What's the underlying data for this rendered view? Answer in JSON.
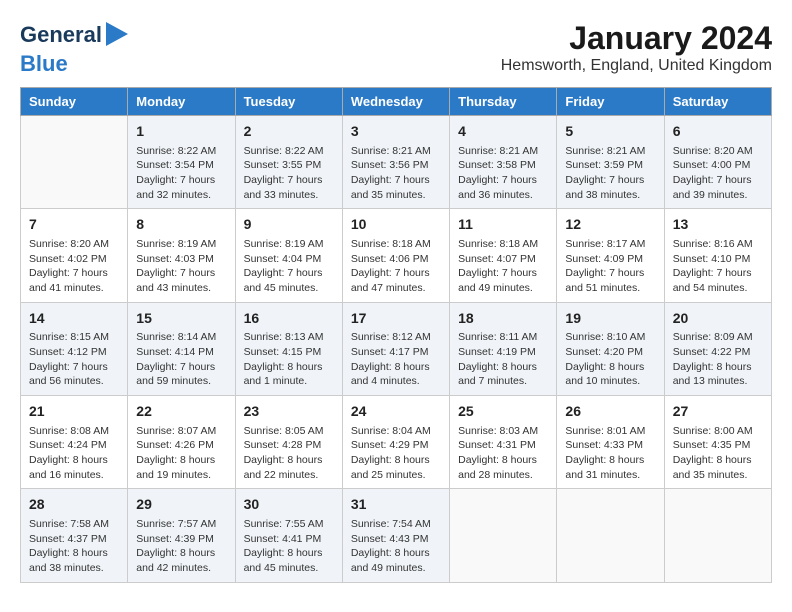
{
  "logo": {
    "line1": "General",
    "line2": "Blue"
  },
  "title": "January 2024",
  "subtitle": "Hemsworth, England, United Kingdom",
  "days_of_week": [
    "Sunday",
    "Monday",
    "Tuesday",
    "Wednesday",
    "Thursday",
    "Friday",
    "Saturday"
  ],
  "weeks": [
    [
      {
        "day": "",
        "sunrise": "",
        "sunset": "",
        "daylight": ""
      },
      {
        "day": "1",
        "sunrise": "Sunrise: 8:22 AM",
        "sunset": "Sunset: 3:54 PM",
        "daylight": "Daylight: 7 hours and 32 minutes."
      },
      {
        "day": "2",
        "sunrise": "Sunrise: 8:22 AM",
        "sunset": "Sunset: 3:55 PM",
        "daylight": "Daylight: 7 hours and 33 minutes."
      },
      {
        "day": "3",
        "sunrise": "Sunrise: 8:21 AM",
        "sunset": "Sunset: 3:56 PM",
        "daylight": "Daylight: 7 hours and 35 minutes."
      },
      {
        "day": "4",
        "sunrise": "Sunrise: 8:21 AM",
        "sunset": "Sunset: 3:58 PM",
        "daylight": "Daylight: 7 hours and 36 minutes."
      },
      {
        "day": "5",
        "sunrise": "Sunrise: 8:21 AM",
        "sunset": "Sunset: 3:59 PM",
        "daylight": "Daylight: 7 hours and 38 minutes."
      },
      {
        "day": "6",
        "sunrise": "Sunrise: 8:20 AM",
        "sunset": "Sunset: 4:00 PM",
        "daylight": "Daylight: 7 hours and 39 minutes."
      }
    ],
    [
      {
        "day": "7",
        "sunrise": "Sunrise: 8:20 AM",
        "sunset": "Sunset: 4:02 PM",
        "daylight": "Daylight: 7 hours and 41 minutes."
      },
      {
        "day": "8",
        "sunrise": "Sunrise: 8:19 AM",
        "sunset": "Sunset: 4:03 PM",
        "daylight": "Daylight: 7 hours and 43 minutes."
      },
      {
        "day": "9",
        "sunrise": "Sunrise: 8:19 AM",
        "sunset": "Sunset: 4:04 PM",
        "daylight": "Daylight: 7 hours and 45 minutes."
      },
      {
        "day": "10",
        "sunrise": "Sunrise: 8:18 AM",
        "sunset": "Sunset: 4:06 PM",
        "daylight": "Daylight: 7 hours and 47 minutes."
      },
      {
        "day": "11",
        "sunrise": "Sunrise: 8:18 AM",
        "sunset": "Sunset: 4:07 PM",
        "daylight": "Daylight: 7 hours and 49 minutes."
      },
      {
        "day": "12",
        "sunrise": "Sunrise: 8:17 AM",
        "sunset": "Sunset: 4:09 PM",
        "daylight": "Daylight: 7 hours and 51 minutes."
      },
      {
        "day": "13",
        "sunrise": "Sunrise: 8:16 AM",
        "sunset": "Sunset: 4:10 PM",
        "daylight": "Daylight: 7 hours and 54 minutes."
      }
    ],
    [
      {
        "day": "14",
        "sunrise": "Sunrise: 8:15 AM",
        "sunset": "Sunset: 4:12 PM",
        "daylight": "Daylight: 7 hours and 56 minutes."
      },
      {
        "day": "15",
        "sunrise": "Sunrise: 8:14 AM",
        "sunset": "Sunset: 4:14 PM",
        "daylight": "Daylight: 7 hours and 59 minutes."
      },
      {
        "day": "16",
        "sunrise": "Sunrise: 8:13 AM",
        "sunset": "Sunset: 4:15 PM",
        "daylight": "Daylight: 8 hours and 1 minute."
      },
      {
        "day": "17",
        "sunrise": "Sunrise: 8:12 AM",
        "sunset": "Sunset: 4:17 PM",
        "daylight": "Daylight: 8 hours and 4 minutes."
      },
      {
        "day": "18",
        "sunrise": "Sunrise: 8:11 AM",
        "sunset": "Sunset: 4:19 PM",
        "daylight": "Daylight: 8 hours and 7 minutes."
      },
      {
        "day": "19",
        "sunrise": "Sunrise: 8:10 AM",
        "sunset": "Sunset: 4:20 PM",
        "daylight": "Daylight: 8 hours and 10 minutes."
      },
      {
        "day": "20",
        "sunrise": "Sunrise: 8:09 AM",
        "sunset": "Sunset: 4:22 PM",
        "daylight": "Daylight: 8 hours and 13 minutes."
      }
    ],
    [
      {
        "day": "21",
        "sunrise": "Sunrise: 8:08 AM",
        "sunset": "Sunset: 4:24 PM",
        "daylight": "Daylight: 8 hours and 16 minutes."
      },
      {
        "day": "22",
        "sunrise": "Sunrise: 8:07 AM",
        "sunset": "Sunset: 4:26 PM",
        "daylight": "Daylight: 8 hours and 19 minutes."
      },
      {
        "day": "23",
        "sunrise": "Sunrise: 8:05 AM",
        "sunset": "Sunset: 4:28 PM",
        "daylight": "Daylight: 8 hours and 22 minutes."
      },
      {
        "day": "24",
        "sunrise": "Sunrise: 8:04 AM",
        "sunset": "Sunset: 4:29 PM",
        "daylight": "Daylight: 8 hours and 25 minutes."
      },
      {
        "day": "25",
        "sunrise": "Sunrise: 8:03 AM",
        "sunset": "Sunset: 4:31 PM",
        "daylight": "Daylight: 8 hours and 28 minutes."
      },
      {
        "day": "26",
        "sunrise": "Sunrise: 8:01 AM",
        "sunset": "Sunset: 4:33 PM",
        "daylight": "Daylight: 8 hours and 31 minutes."
      },
      {
        "day": "27",
        "sunrise": "Sunrise: 8:00 AM",
        "sunset": "Sunset: 4:35 PM",
        "daylight": "Daylight: 8 hours and 35 minutes."
      }
    ],
    [
      {
        "day": "28",
        "sunrise": "Sunrise: 7:58 AM",
        "sunset": "Sunset: 4:37 PM",
        "daylight": "Daylight: 8 hours and 38 minutes."
      },
      {
        "day": "29",
        "sunrise": "Sunrise: 7:57 AM",
        "sunset": "Sunset: 4:39 PM",
        "daylight": "Daylight: 8 hours and 42 minutes."
      },
      {
        "day": "30",
        "sunrise": "Sunrise: 7:55 AM",
        "sunset": "Sunset: 4:41 PM",
        "daylight": "Daylight: 8 hours and 45 minutes."
      },
      {
        "day": "31",
        "sunrise": "Sunrise: 7:54 AM",
        "sunset": "Sunset: 4:43 PM",
        "daylight": "Daylight: 8 hours and 49 minutes."
      },
      {
        "day": "",
        "sunrise": "",
        "sunset": "",
        "daylight": ""
      },
      {
        "day": "",
        "sunrise": "",
        "sunset": "",
        "daylight": ""
      },
      {
        "day": "",
        "sunrise": "",
        "sunset": "",
        "daylight": ""
      }
    ]
  ]
}
